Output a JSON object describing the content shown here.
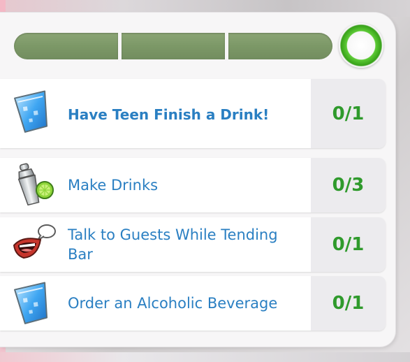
{
  "progress": {
    "segments": 3,
    "filled_segments": 3,
    "complete_ring": "check-ring-icon"
  },
  "tasks": [
    {
      "icon": "glass-of-water-icon",
      "label": "Have Teen Finish a Drink!",
      "count": "0/1"
    },
    {
      "icon": "cocktail-shaker-lime-icon",
      "label": "Make Drinks",
      "count": "0/3"
    },
    {
      "icon": "talking-mouth-icon",
      "label": "Talk to Guests While Tending Bar",
      "count": "0/1"
    },
    {
      "icon": "glass-of-water-icon",
      "label": "Order an Alcoholic Beverage",
      "count": "0/1"
    }
  ],
  "colors": {
    "label": "#2a7fc2",
    "count": "#2f9a2c",
    "progress_fill": "#7c9867",
    "ring": "#3faa1f"
  }
}
